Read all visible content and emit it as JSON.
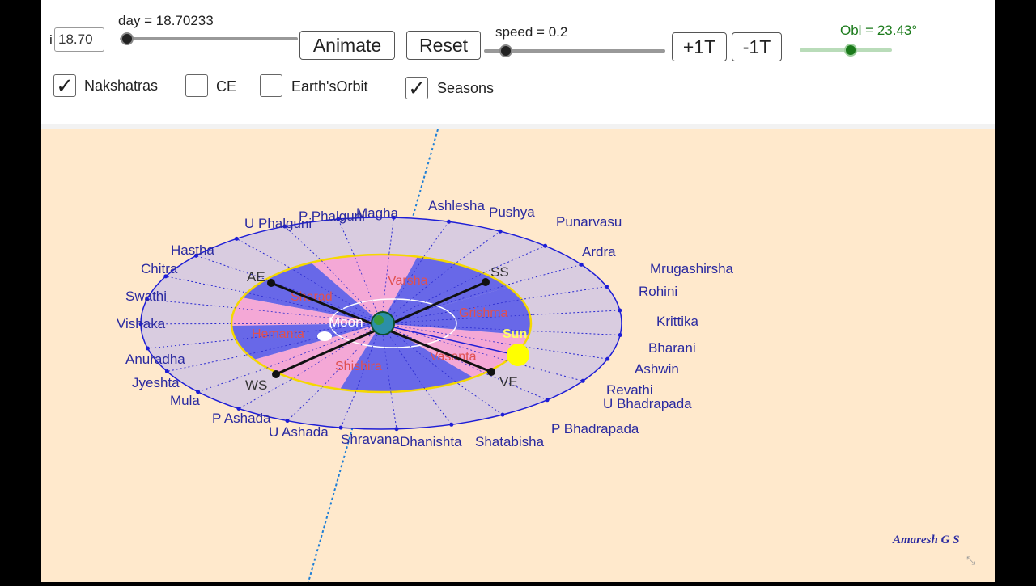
{
  "controls": {
    "i_label": "i",
    "i_value": "18.70",
    "day_label": "day = 18.70233",
    "day_progress": 0.04,
    "animate_label": "Animate",
    "reset_label": "Reset",
    "speed_label": "speed = 0.2",
    "speed_progress": 0.12,
    "plus_label": "+1T",
    "minus_label": "-1T",
    "obl_label": "Obl = 23.43°",
    "obl_progress": 0.55,
    "obl_color": "#1a7a1a"
  },
  "checkboxes": [
    {
      "label": "Nakshatras",
      "checked": true
    },
    {
      "label": "CE",
      "checked": false
    },
    {
      "label": "Earth'sOrbit",
      "checked": false
    },
    {
      "label": "Seasons",
      "checked": true
    }
  ],
  "diagram": {
    "nakshatras": [
      "Ashlesha",
      "Pushya",
      "Punarvasu",
      "Ardra",
      "Mrugashirsha",
      "Rohini",
      "Krittika",
      "Bharani",
      "Ashwin",
      "Revathi",
      "U Bhadrapada",
      "P Bhadrapada",
      "Shatabisha",
      "Dhanishta",
      "Shravana",
      "U Ashada",
      "P Ashada",
      "Mula",
      "Jyeshta",
      "Anuradha",
      "Vishaka",
      "Swathi",
      "Chitra",
      "Hastha",
      "U Phalguni",
      "P Phalguni",
      "Magha"
    ],
    "seasons": [
      "Varsha",
      "Grishma",
      "Vasanta",
      "Shishira",
      "Hemanta",
      "Sharad"
    ],
    "points": {
      "ae": "AE",
      "ss": "SS",
      "ws": "WS",
      "ve": "VE"
    },
    "moon_label": "Moon",
    "sun_label": "Sun",
    "author": "Amaresh G S",
    "colors": {
      "outer_fill": "#d9cce0",
      "outer_stroke": "#1e1ed6",
      "orbit": "#f5d800",
      "blue": "#6868e8",
      "pink": "#f4a8d6",
      "sun": "#ffff00"
    }
  }
}
